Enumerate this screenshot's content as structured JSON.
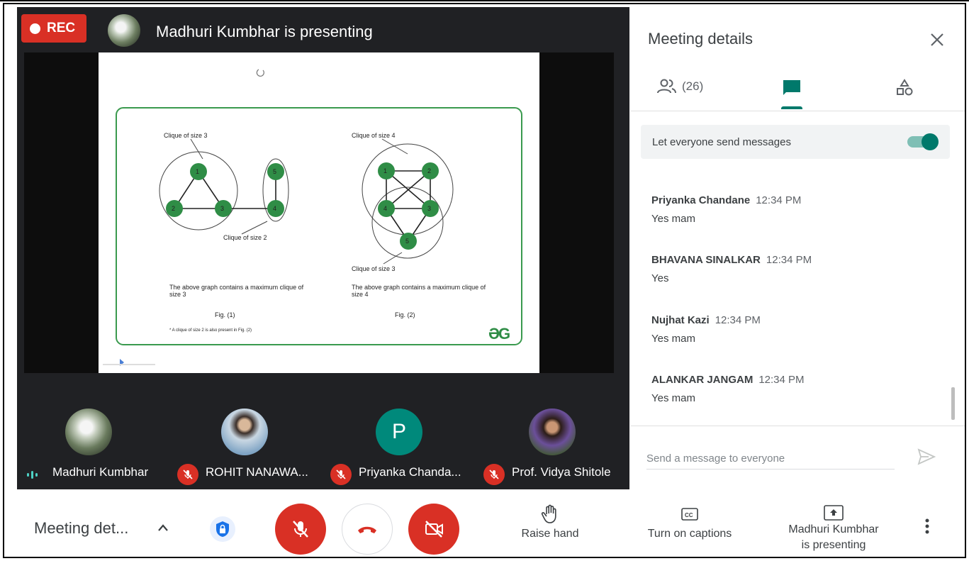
{
  "recording": {
    "label": "REC"
  },
  "stage": {
    "presenting_title": "Madhuri Kumbhar is presenting"
  },
  "slide": {
    "fig1": {
      "top_label": "Clique of size 3",
      "bottom_label": "Clique of size 2",
      "caption": "The above graph contains a maximum clique of size 3",
      "fig_label": "Fig. (1)",
      "footnote": "* A clique of size 2 is also present in Fig. (2)",
      "nodes": [
        "1",
        "2",
        "3",
        "4",
        "5"
      ]
    },
    "fig2": {
      "top_label": "Clique of size 4",
      "bottom_label": "Clique of size 3",
      "caption": "The above graph contains a maximum clique of size 4",
      "fig_label": "Fig. (2)",
      "nodes": [
        "1",
        "2",
        "3",
        "4",
        "5"
      ]
    },
    "logo": "ƏG"
  },
  "participants": [
    {
      "name": "Madhuri Kumbhar",
      "status": "speaking"
    },
    {
      "name": "ROHIT NANAWA...",
      "status": "muted"
    },
    {
      "name": "Priyanka Chanda...",
      "status": "muted",
      "initial": "P"
    },
    {
      "name": "Prof. Vidya Shitole",
      "status": "muted"
    }
  ],
  "panel": {
    "title": "Meeting details",
    "people_count": "(26)",
    "send_setting": "Let everyone send messages",
    "send_setting_on": true,
    "messages": [
      {
        "sender": "Priyanka Chandane",
        "time": "12:34 PM",
        "text": "Yes mam"
      },
      {
        "sender": "BHAVANA SINALKAR",
        "time": "12:34 PM",
        "text": "Yes"
      },
      {
        "sender": "Nujhat Kazi",
        "time": "12:34 PM",
        "text": "Yes mam"
      },
      {
        "sender": "ALANKAR JANGAM",
        "time": "12:34 PM",
        "text": "Yes mam"
      }
    ],
    "input_placeholder": "Send a message to everyone"
  },
  "bottom_bar": {
    "meeting_details": "Meeting det...",
    "raise_hand": "Raise hand",
    "captions": "Turn on captions",
    "presenting_line1": "Madhuri Kumbhar",
    "presenting_line2": "is presenting"
  },
  "colors": {
    "red": "#d93025",
    "teal": "#00796b",
    "node_green": "#2f8d46",
    "stage_bg": "#202124"
  }
}
